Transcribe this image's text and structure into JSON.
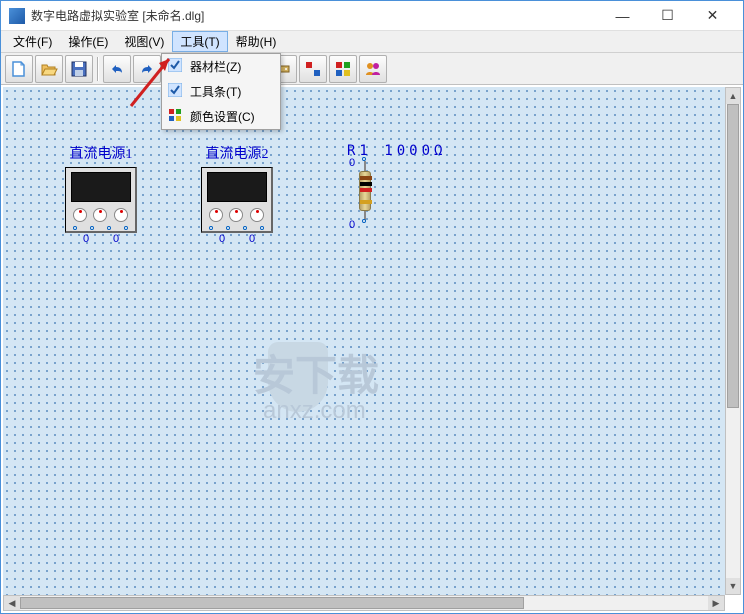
{
  "window": {
    "title": "数字电路虚拟实验室 [未命名.dlg]"
  },
  "menubar": {
    "items": [
      {
        "label": "文件(F)"
      },
      {
        "label": "操作(E)"
      },
      {
        "label": "视图(V)"
      },
      {
        "label": "工具(T)"
      },
      {
        "label": "帮助(H)"
      }
    ]
  },
  "dropdown": {
    "items": [
      {
        "label": "器材栏(Z)",
        "checked": true
      },
      {
        "label": "工具条(T)",
        "checked": true
      },
      {
        "label": "颜色设置(C)",
        "checked": false
      }
    ]
  },
  "toolbar": {
    "icons": [
      "new-file",
      "open-file",
      "save-file",
      "sep",
      "undo",
      "redo",
      "sep",
      "run",
      "stop",
      "pause",
      "sep",
      "component1",
      "component2",
      "grid-color",
      "users"
    ]
  },
  "devices": {
    "psu1": {
      "label": "直流电源1",
      "pins": [
        "0",
        "0"
      ]
    },
    "psu2": {
      "label": "直流电源2",
      "pins": [
        "0",
        "0"
      ]
    },
    "resistor1": {
      "label": "R1 1000Ω",
      "pin_top": "0",
      "pin_bottom": "0"
    }
  },
  "watermark": {
    "text": "安下载",
    "sub": "anxz.com"
  }
}
